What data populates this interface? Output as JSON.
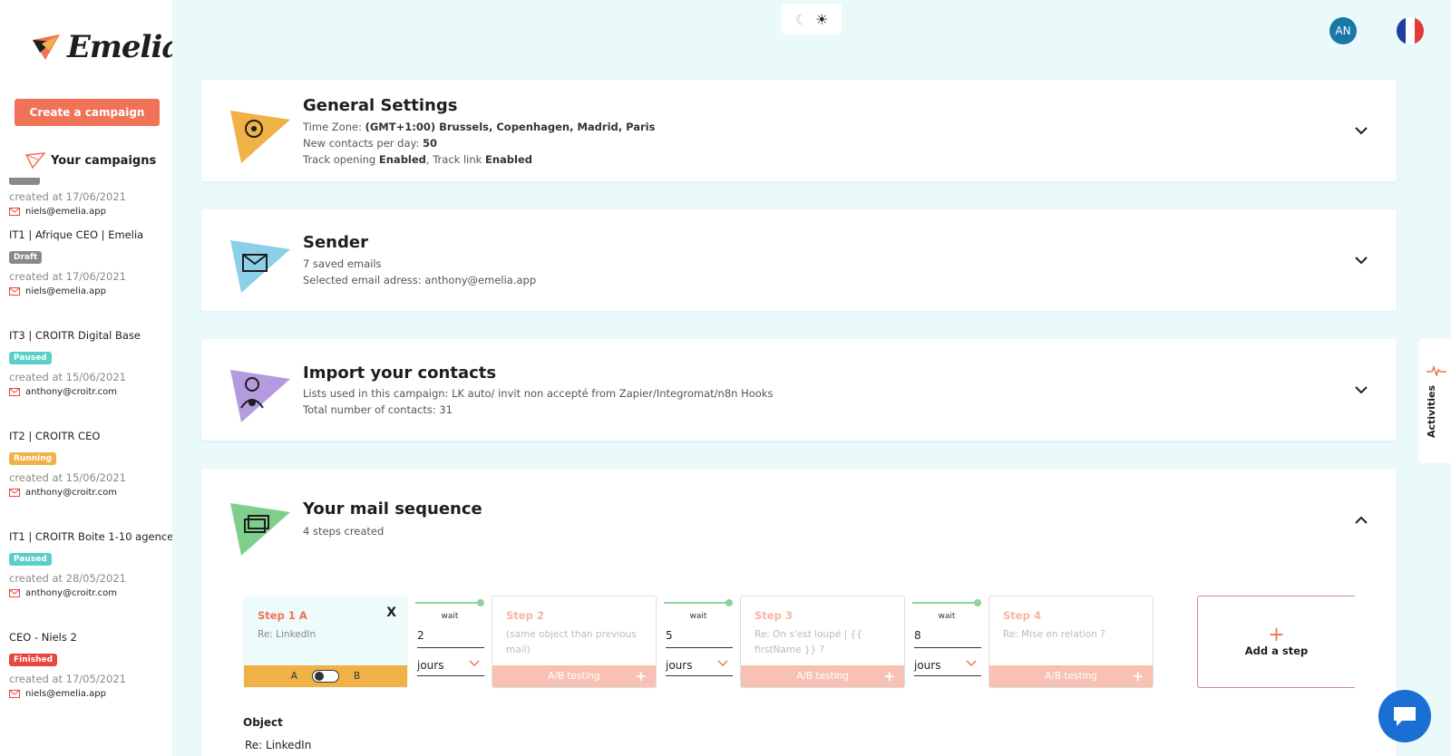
{
  "app": {
    "logo_text": "Emelia"
  },
  "sidebar": {
    "create_label": "Create a campaign",
    "section_title": "Your campaigns",
    "campaigns": [
      {
        "name": "",
        "badge": "",
        "badge_color": "#8a8a8a",
        "date": "created at 17/06/2021",
        "email": "niels@emelia.app"
      },
      {
        "name": "IT1 | Afrique CEO | Emelia",
        "badge": "Draft",
        "badge_color": "#8a8a8a",
        "date": "created at 17/06/2021",
        "email": "niels@emelia.app"
      },
      {
        "name": "IT3 | CROITR Digital Base",
        "badge": "Paused",
        "badge_color": "#59d0c6",
        "date": "created at 15/06/2021",
        "email": "anthony@croitr.com"
      },
      {
        "name": "IT2 | CROITR CEO",
        "badge": "Running",
        "badge_color": "#f0b247",
        "date": "created at 15/06/2021",
        "email": "anthony@croitr.com"
      },
      {
        "name": "IT1 | CROITR Boite 1-10 agence",
        "badge": "Paused",
        "badge_color": "#59d0c6",
        "date": "created at 28/05/2021",
        "email": "anthony@croitr.com"
      },
      {
        "name": "CEO - Niels 2",
        "badge": "Finished",
        "badge_color": "#e8463f",
        "date": "created at 17/05/2021",
        "email": "niels@emelia.app"
      }
    ]
  },
  "topbar": {
    "avatar_initials": "AN",
    "theme_icons": [
      "moon-icon",
      "sun-icon"
    ]
  },
  "general": {
    "title": "General Settings",
    "tz_label": "Time Zone:",
    "tz_value": "(GMT+1:00) Brussels, Copenhagen, Madrid, Paris",
    "contacts_label": "New contacts per day:",
    "contacts_value": "50",
    "track_label1": "Track opening",
    "track_value1": "Enabled",
    "track_label2": ", Track link",
    "track_value2": "Enabled"
  },
  "sender": {
    "title": "Sender",
    "saved": "7 saved emails",
    "selected": "Selected email adress: anthony@emelia.app"
  },
  "import": {
    "title": "Import your contacts",
    "lists": "Lists used in this campaign: LK auto/ invit non accepté from Zapier/Integromat/n8n Hooks",
    "total": "Total number of contacts: 31"
  },
  "sequence": {
    "title": "Your mail sequence",
    "subtitle": "4 steps created",
    "steps": [
      {
        "title": "Step 1 A",
        "subject": "Re: LinkedIn",
        "close": "X",
        "ab_a": "A",
        "ab_b": "B"
      },
      {
        "title": "Step 2",
        "subject": "(same object than previous mail)",
        "footer": "A/B testing"
      },
      {
        "title": "Step 3",
        "subject": "Re: On s'est loupé | {{ firstName }} ?",
        "footer": "A/B testing"
      },
      {
        "title": "Step 4",
        "subject": "Re: Mise en relation ?",
        "footer": "A/B testing"
      }
    ],
    "waits": [
      {
        "label": "wait",
        "value": "2",
        "unit": "jours"
      },
      {
        "label": "wait",
        "value": "5",
        "unit": "jours"
      },
      {
        "label": "wait",
        "value": "8",
        "unit": "jours"
      }
    ],
    "add_step": "Add a step",
    "add_plus": "+",
    "step_plus": "+",
    "object_label": "Object",
    "object_value": "Re: LinkedIn"
  },
  "activities": {
    "label": "Activities"
  },
  "colors": {
    "accent": "#f07257",
    "bg": "#eafafa",
    "green": "#8ed39a",
    "blue": "#1a6fd4"
  }
}
